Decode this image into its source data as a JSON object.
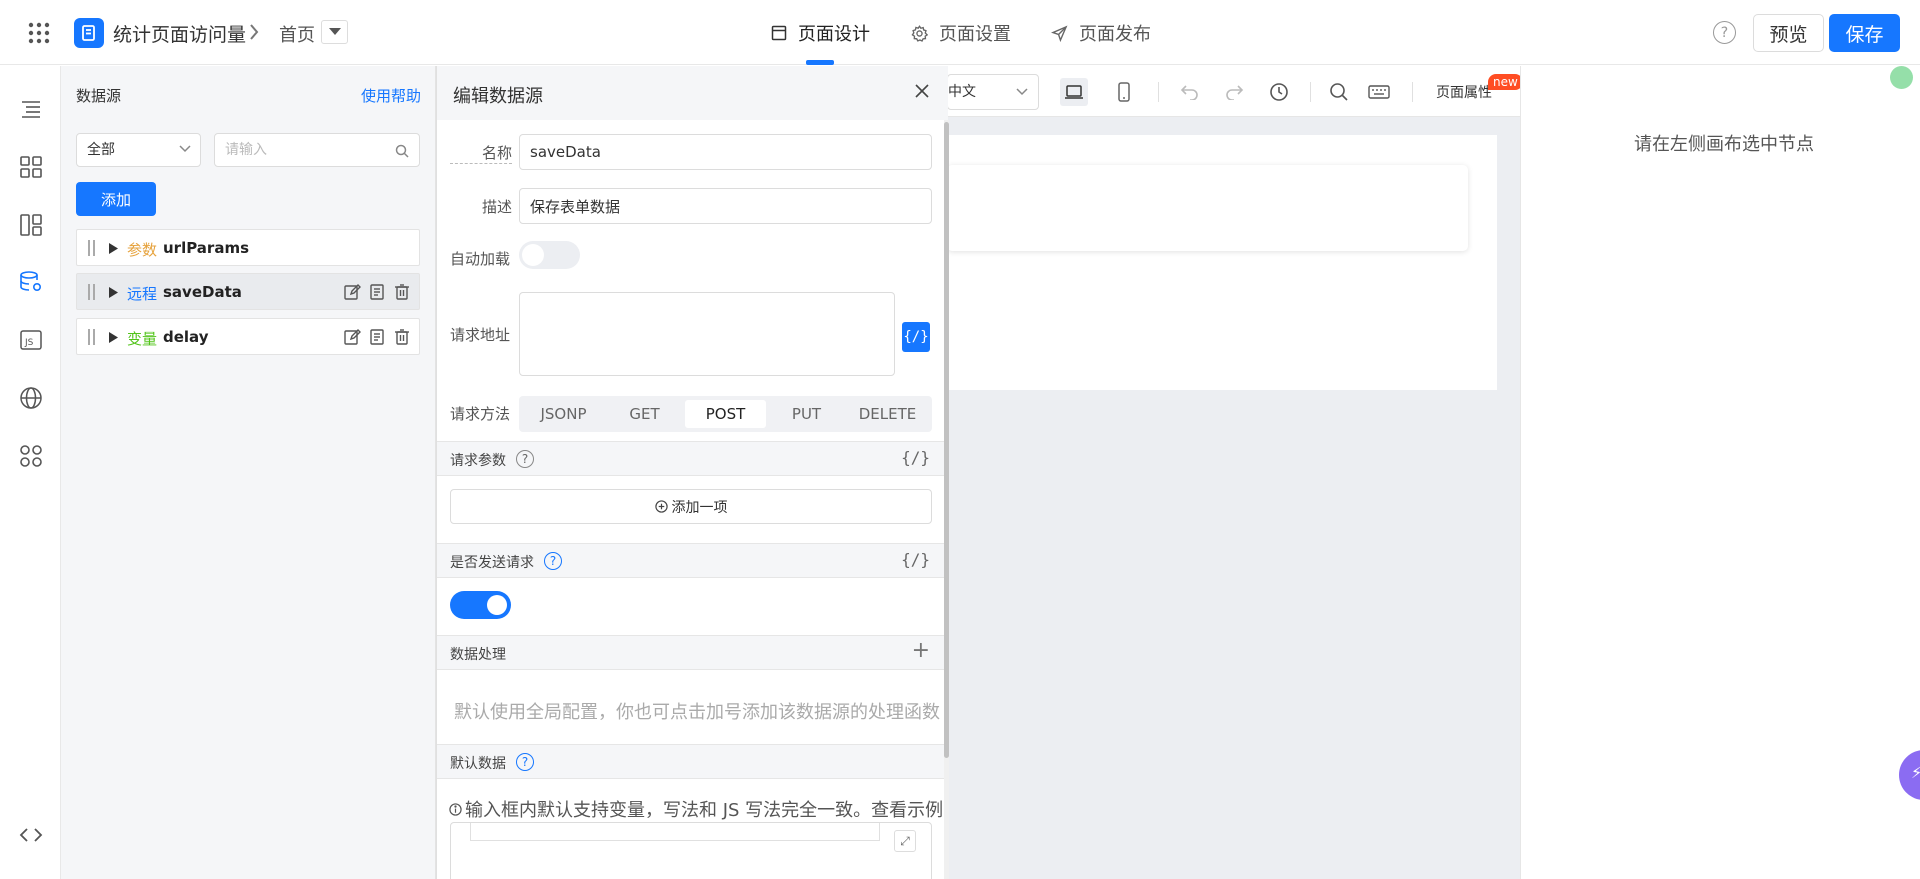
{
  "header": {
    "app_title": "统计页面访问量",
    "current_page": "首页",
    "tabs": [
      {
        "label": "页面设计",
        "icon": "layout-icon"
      },
      {
        "label": "页面设置",
        "icon": "gear-icon"
      },
      {
        "label": "页面发布",
        "icon": "send-icon"
      }
    ],
    "help_symbol": "?",
    "preview_label": "预览",
    "save_label": "保存"
  },
  "datasource_panel": {
    "title": "数据源",
    "help_link": "使用帮助",
    "filter_value": "全部",
    "search_placeholder": "请输入",
    "add_label": "添加",
    "items": [
      {
        "kind": "参数",
        "name": "urlParams",
        "kind_color": "#e6a23c"
      },
      {
        "kind": "远程",
        "name": "saveData",
        "kind_color": "#1677ff"
      },
      {
        "kind": "变量",
        "name": "delay",
        "kind_color": "#52c41a"
      }
    ]
  },
  "toolbar": {
    "language": "中文",
    "page_attrs": "页面属性",
    "new_badge": "new"
  },
  "right_panel": {
    "hint": "请在左侧画布选中节点"
  },
  "drawer": {
    "title": "编辑数据源",
    "fields": {
      "name_label": "名称",
      "name_value": "saveData",
      "desc_label": "描述",
      "desc_value": "保存表单数据",
      "autoload_label": "自动加载",
      "url_label": "请求地址",
      "method_label": "请求方法"
    },
    "methods": [
      "JSONP",
      "GET",
      "POST",
      "PUT",
      "DELETE"
    ],
    "selected_method": "POST",
    "fx_symbol": "{/}",
    "sections": {
      "params_title": "请求参数",
      "add_item": "添加一项",
      "send_title": "是否发送请求",
      "proc_title": "数据处理",
      "proc_hint": "默认使用全局配置，你也可点击加号添加该数据源的处理函数",
      "default_title": "默认数据",
      "default_hint": "输入框内默认支持变量，写法和 JS 写法完全一致。查看示例"
    }
  },
  "colors": {
    "primary": "#1677ff"
  }
}
